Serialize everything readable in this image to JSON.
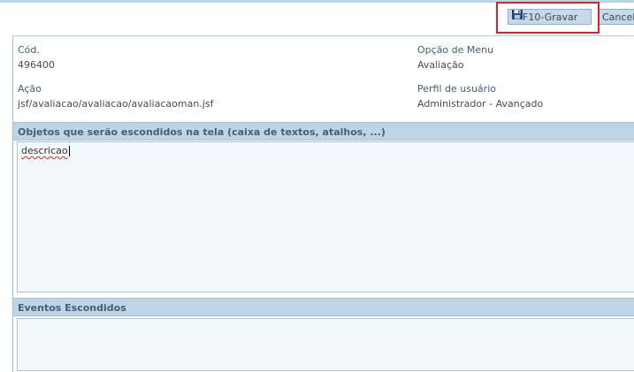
{
  "toolbar": {
    "save_label": "F10-Gravar",
    "cancel_label": "Cancelar"
  },
  "fields": {
    "cod_label": "Cód.",
    "cod_value": "496400",
    "opcao_label": "Opção de Menu",
    "opcao_value": "Avaliação",
    "acao_label": "Ação",
    "acao_value": "jsf/avaliacao/avaliacao/avaliacaoman.jsf",
    "perfil_label": "Perfil de usuário",
    "perfil_value": "Administrador - Avançado"
  },
  "sections": {
    "objetos_title": "Objetos que serão escondidos na tela (caixa de textos, atalhos, ...)",
    "objetos_value": "descricao",
    "eventos_title": "Eventos Escondidos",
    "eventos_value": ""
  },
  "colors": {
    "header_bg": "#bcd6e8",
    "button_bg": "#c4d9ea",
    "highlight": "#d9232c",
    "textarea_bg": "#f2f7fb"
  },
  "icons": {
    "save": "floppy-disk-icon"
  }
}
